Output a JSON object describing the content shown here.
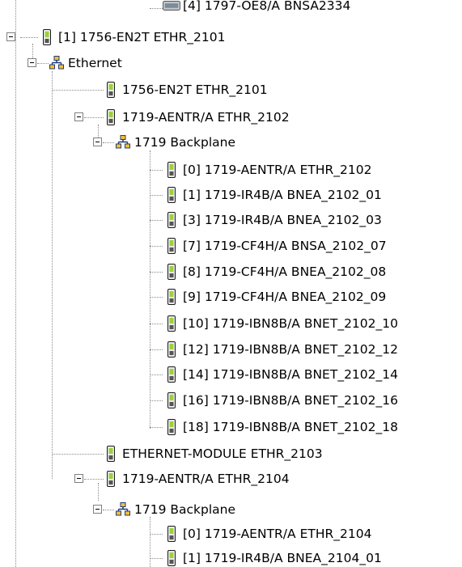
{
  "tree": {
    "nodes": [
      {
        "icon": "module-card-icon",
        "label": "[4] 1797-OE8/A BNSA2334"
      },
      {
        "icon": "module-card-icon",
        "label": "[1] 1756-EN2T ETHR_2101"
      },
      {
        "icon": "ethernet-network-icon",
        "label": "Ethernet"
      },
      {
        "icon": "module-card-icon",
        "label": "1756-EN2T ETHR_2101"
      },
      {
        "icon": "module-card-icon",
        "label": "1719-AENTR/A ETHR_2102"
      },
      {
        "icon": "backplane-network-icon",
        "label": "1719 Backplane"
      },
      {
        "icon": "module-card-icon",
        "label": "[0] 1719-AENTR/A ETHR_2102"
      },
      {
        "icon": "module-card-icon",
        "label": "[1] 1719-IR4B/A BNEA_2102_01"
      },
      {
        "icon": "module-card-icon",
        "label": "[3] 1719-IR4B/A BNEA_2102_03"
      },
      {
        "icon": "module-card-icon",
        "label": "[7] 1719-CF4H/A BNSA_2102_07"
      },
      {
        "icon": "module-card-icon",
        "label": "[8] 1719-CF4H/A BNEA_2102_08"
      },
      {
        "icon": "module-card-icon",
        "label": "[9] 1719-CF4H/A BNEA_2102_09"
      },
      {
        "icon": "module-card-icon",
        "label": "[10] 1719-IBN8B/A BNET_2102_10"
      },
      {
        "icon": "module-card-icon",
        "label": "[12] 1719-IBN8B/A BNET_2102_12"
      },
      {
        "icon": "module-card-icon",
        "label": "[14] 1719-IBN8B/A BNET_2102_14"
      },
      {
        "icon": "module-card-icon",
        "label": "[16] 1719-IBN8B/A BNET_2102_16"
      },
      {
        "icon": "module-card-icon",
        "label": "[18] 1719-IBN8B/A BNET_2102_18"
      },
      {
        "icon": "module-card-icon",
        "label": "ETHERNET-MODULE ETHR_2103"
      },
      {
        "icon": "module-card-icon",
        "label": "1719-AENTR/A ETHR_2104"
      },
      {
        "icon": "backplane-network-icon",
        "label": "1719 Backplane"
      },
      {
        "icon": "module-card-icon",
        "label": "[0] 1719-AENTR/A ETHR_2104"
      },
      {
        "icon": "module-card-icon",
        "label": "[1] 1719-IR4B/A BNEA_2104_01"
      }
    ]
  }
}
